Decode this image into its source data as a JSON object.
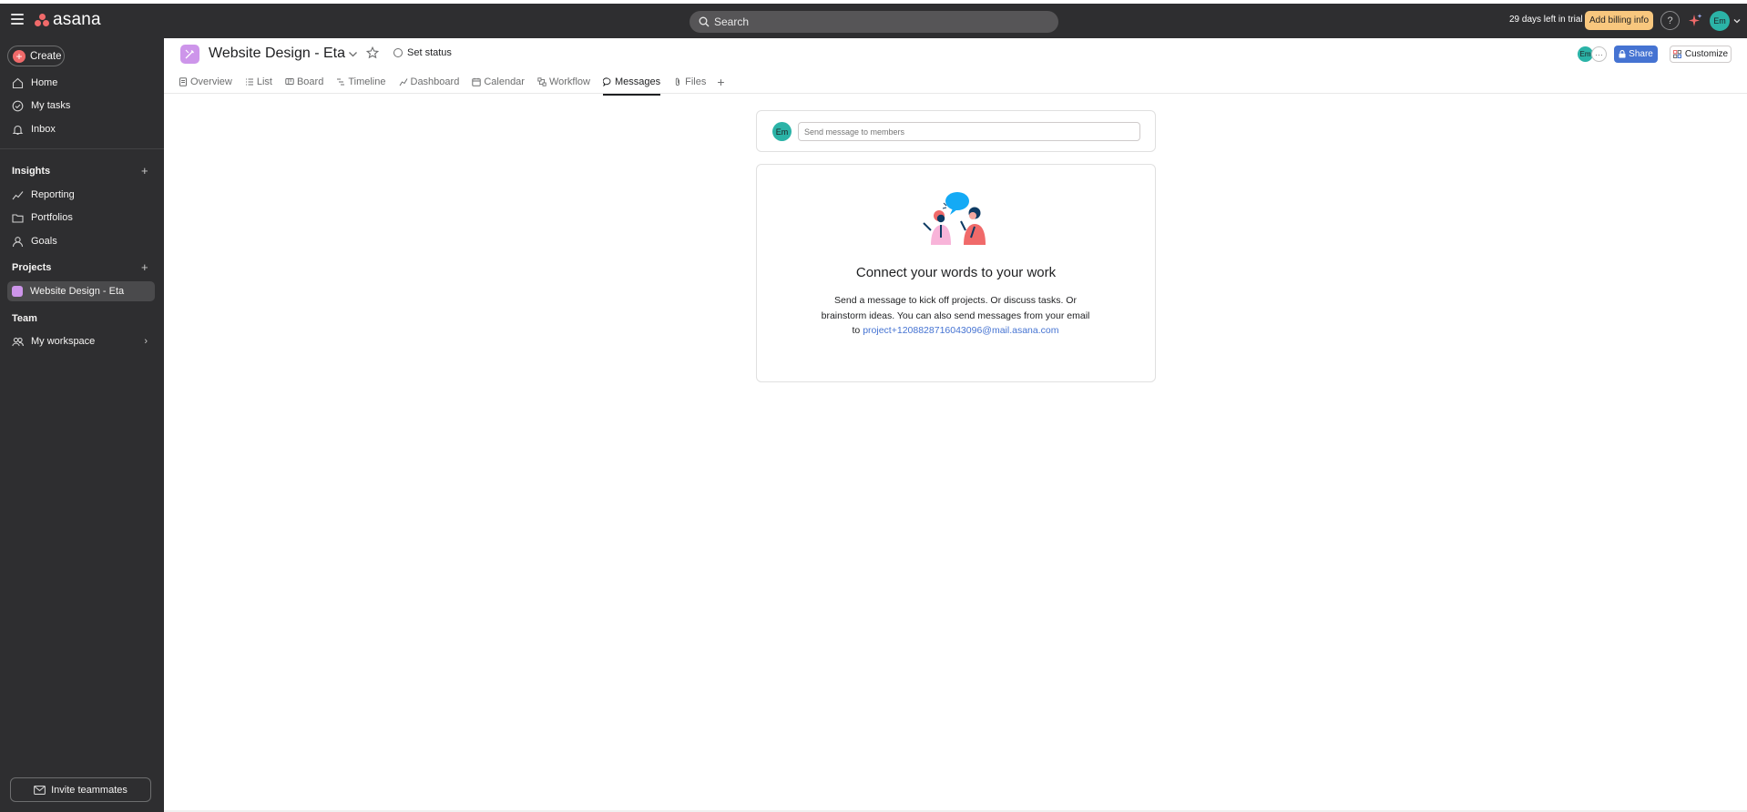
{
  "topbar": {
    "logo_text": "asana",
    "search_placeholder": "Search",
    "trial_text": "29 days left in trial",
    "billing_label": "Add billing info",
    "help_label": "?",
    "user_initials": "Em"
  },
  "sidebar": {
    "create_label": "Create",
    "nav": [
      {
        "label": "Home",
        "icon": "home-icon"
      },
      {
        "label": "My tasks",
        "icon": "check-circle-icon"
      },
      {
        "label": "Inbox",
        "icon": "bell-icon"
      }
    ],
    "insights_heading": "Insights",
    "insights": [
      {
        "label": "Reporting",
        "icon": "chart-line-icon"
      },
      {
        "label": "Portfolios",
        "icon": "folder-icon"
      },
      {
        "label": "Goals",
        "icon": "person-icon"
      }
    ],
    "projects_heading": "Projects",
    "projects": [
      {
        "label": "Website Design - Eta",
        "color": "#cd95ea"
      }
    ],
    "team_heading": "Team",
    "team": [
      {
        "label": "My workspace",
        "icon": "people-icon"
      }
    ],
    "invite_label": "Invite teammates"
  },
  "header": {
    "project_title": "Website Design - Eta",
    "set_status_label": "Set status",
    "member_initials": "Em",
    "more_label": "···",
    "share_label": "Share",
    "customize_label": "Customize"
  },
  "tabs": [
    {
      "label": "Overview",
      "active": false
    },
    {
      "label": "List",
      "active": false
    },
    {
      "label": "Board",
      "active": false
    },
    {
      "label": "Timeline",
      "active": false
    },
    {
      "label": "Dashboard",
      "active": false
    },
    {
      "label": "Calendar",
      "active": false
    },
    {
      "label": "Workflow",
      "active": false
    },
    {
      "label": "Messages",
      "active": true
    },
    {
      "label": "Files",
      "active": false
    }
  ],
  "composer": {
    "avatar_initials": "Em",
    "placeholder": "Send message to members"
  },
  "empty_state": {
    "title": "Connect your words to your work",
    "body": "Send a message to kick off projects. Or discuss tasks. Or brainstorm ideas. You can also send messages from your email to",
    "email": "project+1208828716043096@mail.asana.com"
  },
  "colors": {
    "topbar_bg": "#2e2e30",
    "accent_blue": "#4573d2",
    "brand_coral": "#f06a6a",
    "billing_yellow": "#f8c77e",
    "project_purple": "#cd95ea",
    "avatar_teal": "#2bb3a7"
  }
}
